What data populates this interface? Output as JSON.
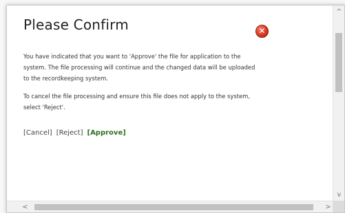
{
  "dialog": {
    "title": "Please Confirm",
    "close_icon": "close-icon",
    "paragraph_1": "You have indicated that you want to 'Approve' the file for application to the system. The file processing will continue and the changed data will be uploaded to the recordkeeping system.",
    "paragraph_2": "To cancel the file processing and ensure this file does not apply to the system, select 'Reject'.",
    "actions": {
      "cancel": "[Cancel]",
      "reject": "[Reject]",
      "approve": "[Approve]"
    }
  },
  "scrollbars": {
    "vertical": {
      "up_icon": "chevron-up-icon",
      "down_icon": "chevron-down-icon",
      "up_glyph": "^",
      "down_glyph": "v"
    },
    "horizontal": {
      "left_icon": "chevron-left-icon",
      "right_icon": "chevron-right-icon",
      "left_glyph": "<",
      "right_glyph": ">"
    }
  },
  "colors": {
    "approve": "#2e6f1f",
    "close_button": "#d93a22",
    "text": "#333333"
  }
}
